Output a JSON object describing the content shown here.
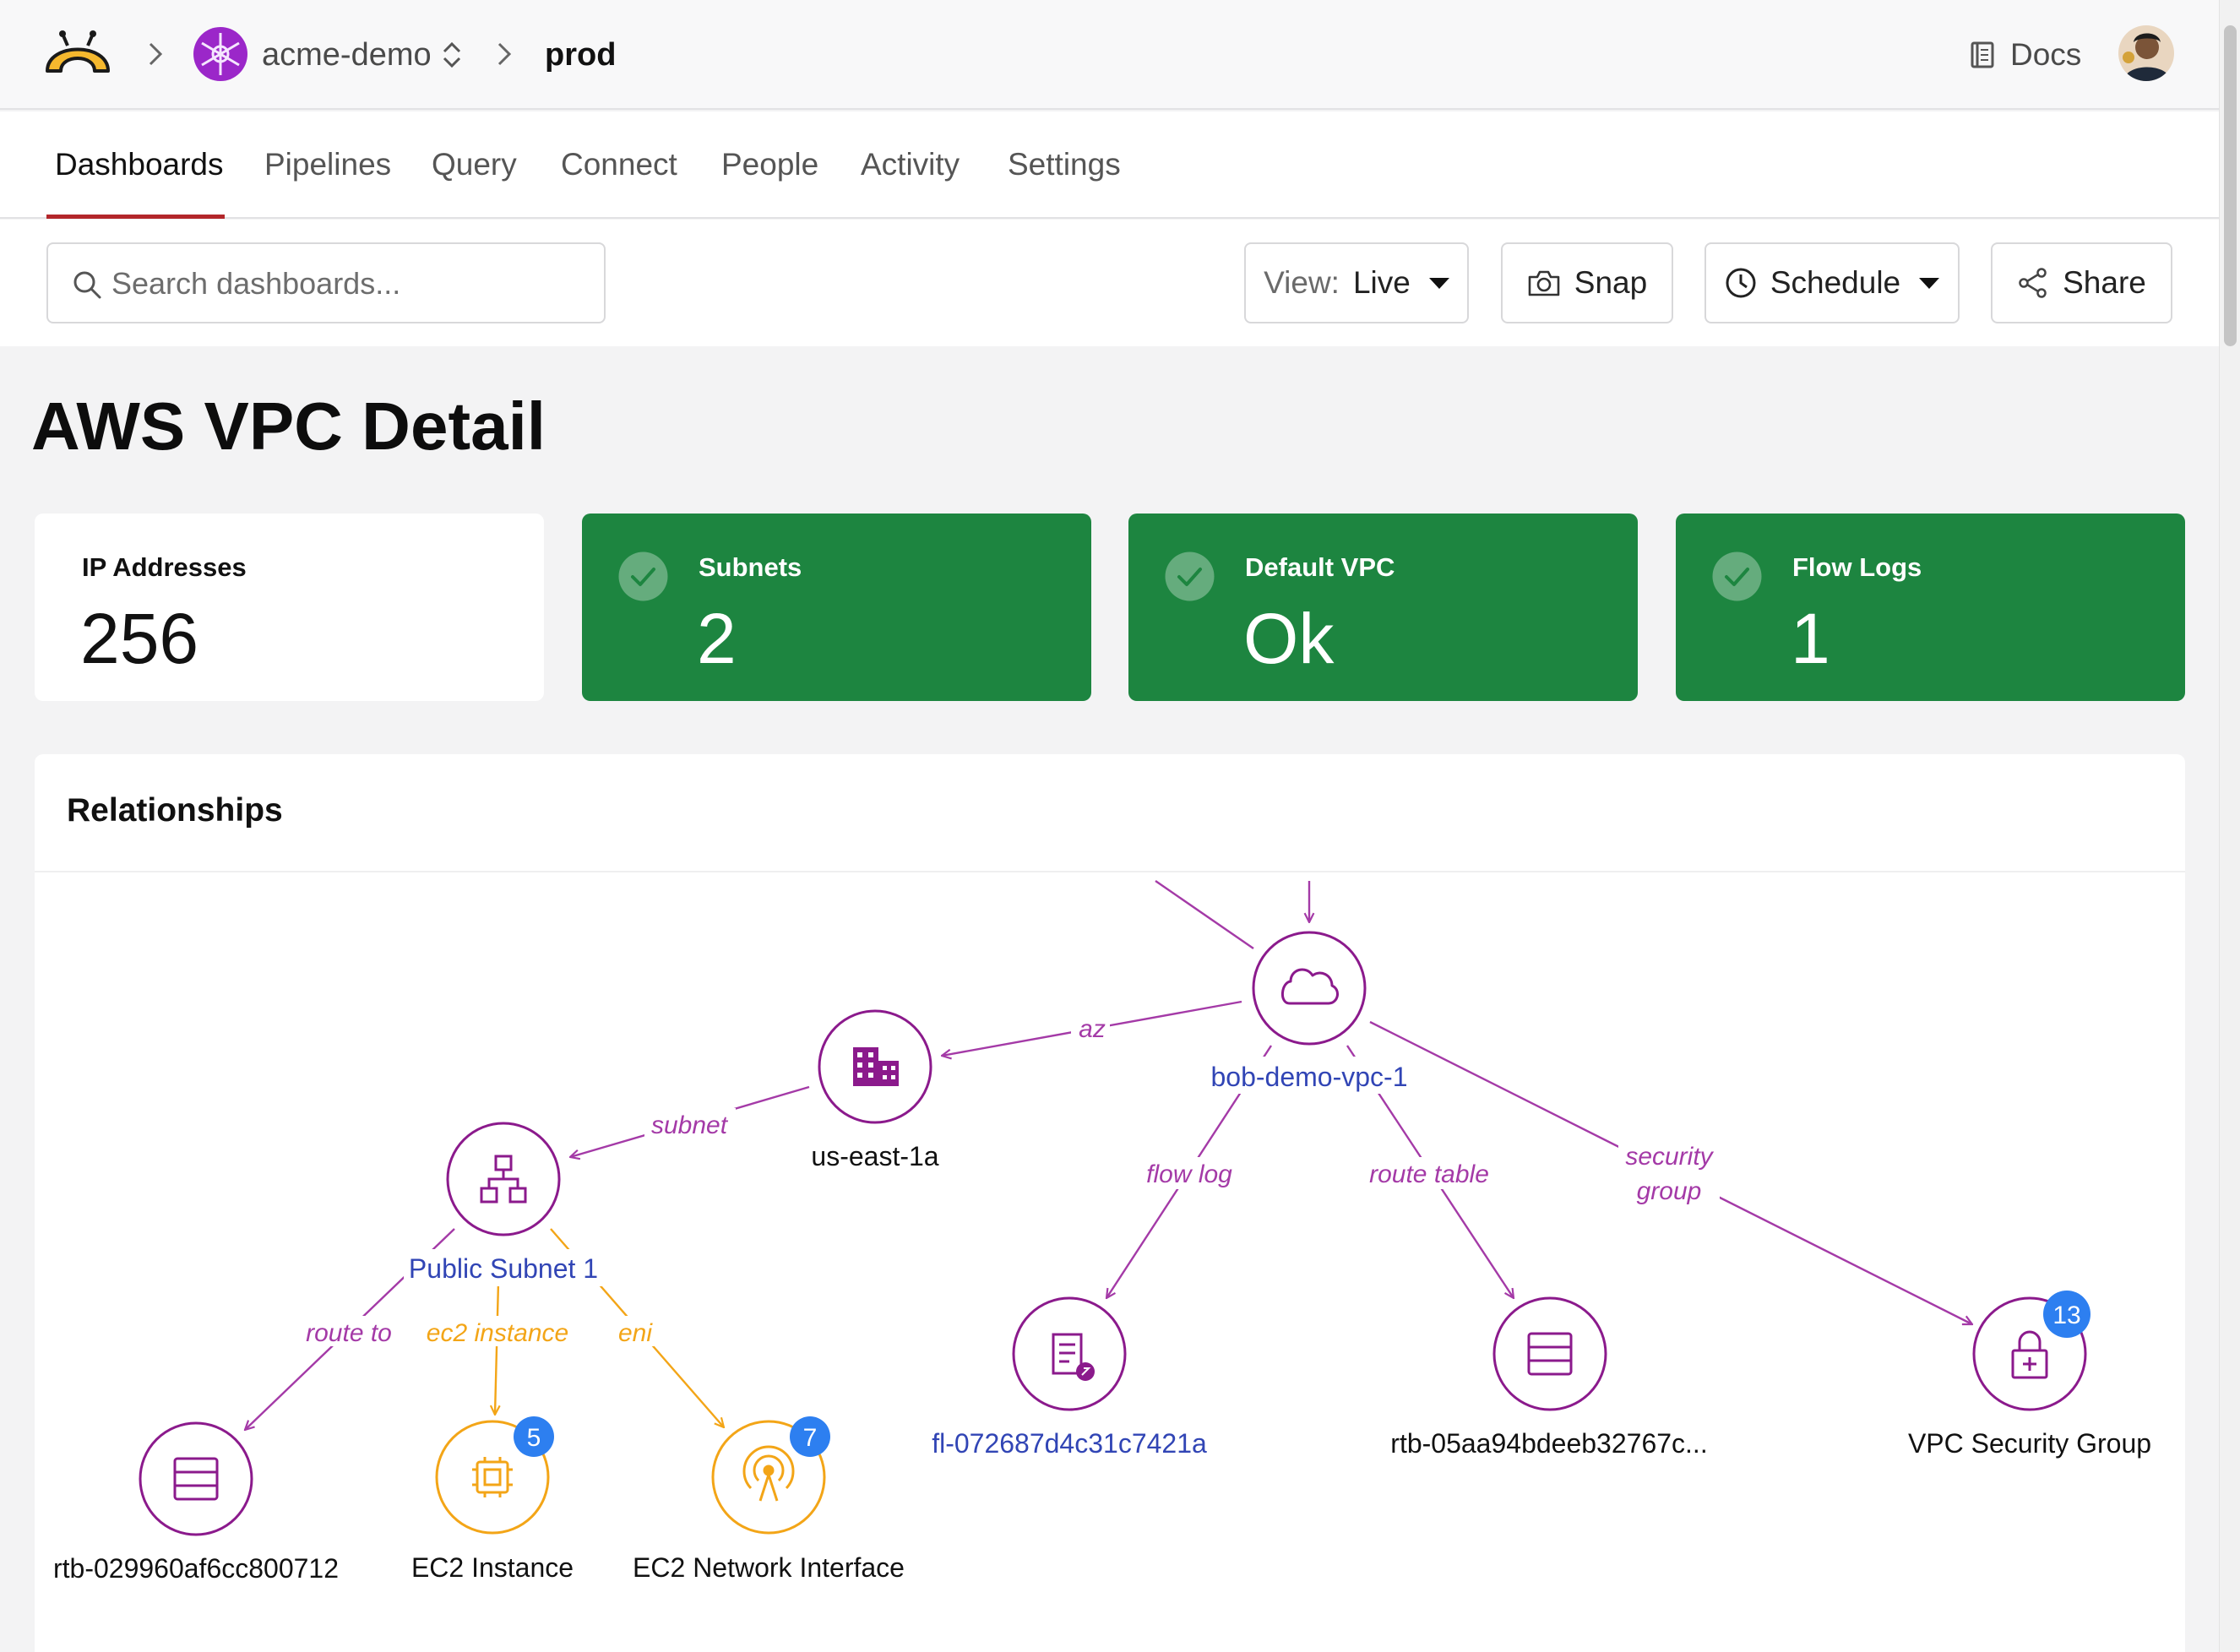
{
  "breadcrumb": {
    "org": "acme-demo",
    "workspace": "prod"
  },
  "header": {
    "docs_label": "Docs"
  },
  "tabs": [
    "Dashboards",
    "Pipelines",
    "Query",
    "Connect",
    "People",
    "Activity",
    "Settings"
  ],
  "active_tab": "Dashboards",
  "search": {
    "placeholder": "Search dashboards..."
  },
  "toolbar": {
    "view_label": "View:",
    "view_value": "Live",
    "snap_label": "Snap",
    "schedule_label": "Schedule",
    "share_label": "Share"
  },
  "page_title": "AWS VPC Detail",
  "cards": [
    {
      "label": "IP Addresses",
      "value": "256",
      "status": "neutral"
    },
    {
      "label": "Subnets",
      "value": "2",
      "status": "ok"
    },
    {
      "label": "Default VPC",
      "value": "Ok",
      "status": "ok"
    },
    {
      "label": "Flow Logs",
      "value": "1",
      "status": "ok"
    }
  ],
  "relationships": {
    "title": "Relationships",
    "nodes": {
      "vpc": {
        "label": "bob-demo-vpc-1",
        "icon": "cloud-icon"
      },
      "az": {
        "label": "us-east-1a",
        "icon": "building-icon"
      },
      "subnet": {
        "label": "Public Subnet 1",
        "icon": "network-tree-icon"
      },
      "rtb1": {
        "label": "rtb-029960af6cc800712",
        "icon": "table-icon"
      },
      "ec2": {
        "label": "EC2 Instance",
        "icon": "chip-icon",
        "count": "5"
      },
      "eni": {
        "label": "EC2 Network Interface",
        "icon": "antenna-icon",
        "count": "7"
      },
      "flowlog": {
        "label": "fl-072687d4c31c7421a",
        "icon": "log-icon"
      },
      "rtb2": {
        "label": "rtb-05aa94bdeeb32767c...",
        "icon": "table-icon"
      },
      "sg": {
        "label": "VPC Security Group",
        "icon": "lock-icon",
        "count": "13"
      }
    },
    "edges": {
      "az": "az",
      "subnet": "subnet",
      "flow_log": "flow log",
      "route_table": "route table",
      "security": "security",
      "group": "group",
      "route_to": "route to",
      "ec2_instance": "ec2 instance",
      "eni": "eni"
    }
  },
  "colors": {
    "accent_red": "#b3262a",
    "ok_green": "#1d8540",
    "purple": "#8b1a8c",
    "orange": "#f3a517",
    "link_blue": "#3145b5",
    "badge_blue": "#2d7ff0"
  }
}
